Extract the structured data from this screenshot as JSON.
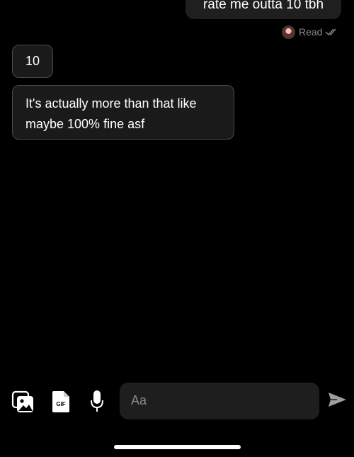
{
  "messages": {
    "outgoing": [
      {
        "text": "rate me outta 10 tbh"
      }
    ],
    "read_receipt": {
      "label": "Read"
    },
    "incoming": [
      {
        "text": "10"
      },
      {
        "text": "It's actually more than that like maybe 100% fine asf"
      }
    ]
  },
  "composer": {
    "placeholder": "Aa",
    "value": ""
  },
  "toolbar": {
    "gif_label": "GIF",
    "icons": [
      "photo-icon",
      "gif-icon",
      "microphone-icon",
      "send-icon"
    ]
  },
  "colors": {
    "background": "#000000",
    "bubble_outgoing": "#1f1f1f",
    "bubble_incoming": "#1a1a1a",
    "bubble_border": "#4a4a4a",
    "muted_text": "#8a8a8a"
  }
}
